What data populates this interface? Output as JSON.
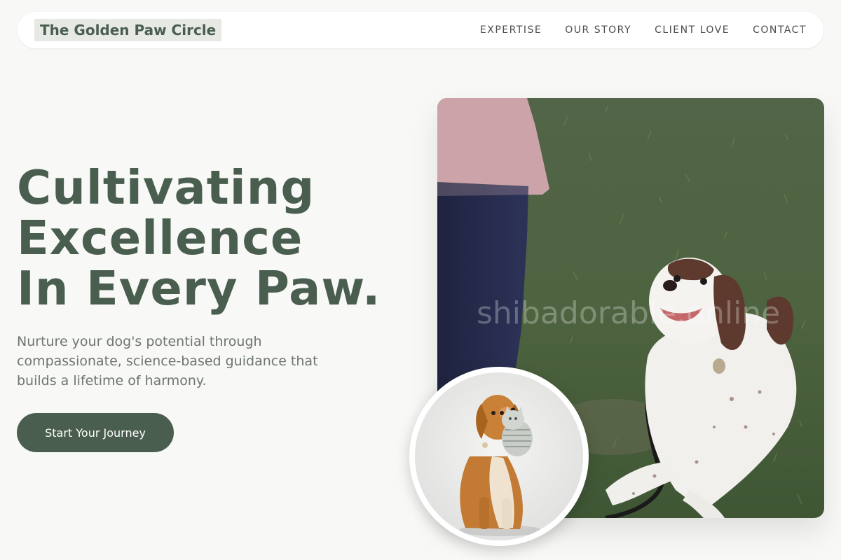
{
  "header": {
    "brand": "The Golden Paw Circle",
    "nav": [
      "EXPERTISE",
      "OUR STORY",
      "CLIENT LOVE",
      "CONTACT"
    ]
  },
  "hero": {
    "headline": [
      "Cultivating",
      "Excellence",
      "In Every Paw."
    ],
    "subtitle": "Nurture your dog's potential through compassionate, science-based guidance that builds a lifetime of harmony.",
    "cta": "Start Your Journey"
  },
  "images": {
    "main_watermark": "shibadorable.online"
  },
  "colors": {
    "accent": "#4a5e4f",
    "background": "#f8f8f6",
    "muted_text": "#6d766f"
  }
}
